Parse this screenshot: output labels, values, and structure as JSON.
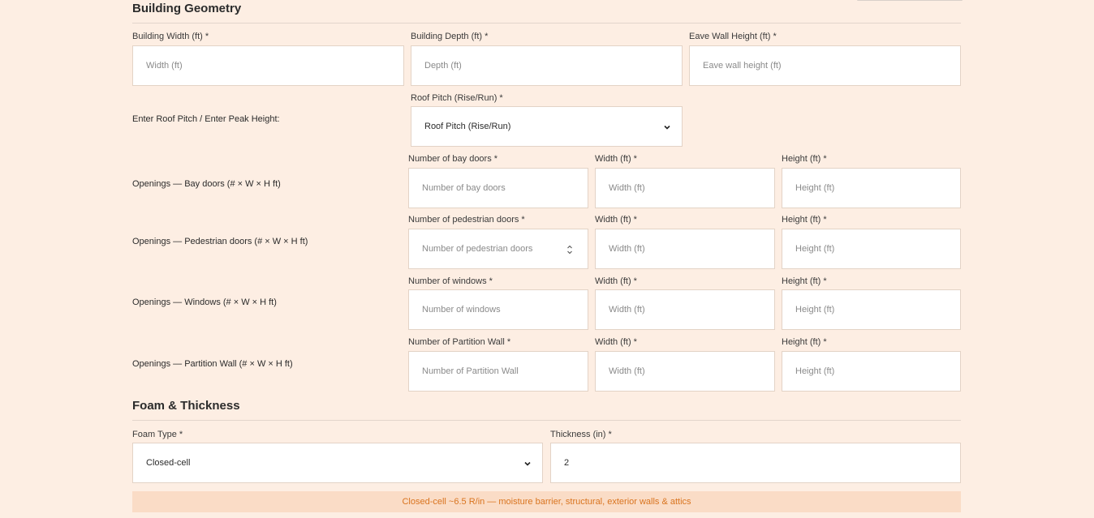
{
  "geometry": {
    "title": "Building Geometry",
    "width_label": "Building Width (ft) *",
    "width_placeholder": "Width (ft)",
    "depth_label": "Building Depth (ft) *",
    "depth_placeholder": "Depth (ft)",
    "eave_label": "Eave Wall Height (ft) *",
    "eave_placeholder": "Eave wall height (ft)",
    "roof_row_label": "Enter Roof Pitch / Enter Peak Height:",
    "roof_label": "Roof Pitch (Rise/Run) *",
    "roof_value": "Roof Pitch (Rise/Run)"
  },
  "openings": [
    {
      "row_label": "Openings — Bay doors (# × W × H ft)",
      "count_label": "Number of bay doors *",
      "count_placeholder": "Number of bay doors",
      "width_label": "Width (ft) *",
      "width_placeholder": "Width (ft)",
      "height_label": "Height (ft) *",
      "height_placeholder": "Height (ft)"
    },
    {
      "row_label": "Openings — Pedestrian doors (# × W × H ft)",
      "count_label": "Number of pedestrian doors *",
      "count_placeholder": "Number of pedestrian doors",
      "width_label": "Width (ft) *",
      "width_placeholder": "Width (ft)",
      "height_label": "Height (ft) *",
      "height_placeholder": "Height (ft)"
    },
    {
      "row_label": "Openings — Windows (# × W × H ft)",
      "count_label": "Number of windows *",
      "count_placeholder": "Number of windows",
      "width_label": "Width (ft) *",
      "width_placeholder": "Width (ft)",
      "height_label": "Height (ft) *",
      "height_placeholder": "Height (ft)"
    },
    {
      "row_label": "Openings — Partition Wall (# × W × H ft)",
      "count_label": "Number of Partition Wall *",
      "count_placeholder": "Number of Partition Wall",
      "width_label": "Width (ft) *",
      "width_placeholder": "Width (ft)",
      "height_label": "Height (ft) *",
      "height_placeholder": "Height (ft)"
    }
  ],
  "foam": {
    "title": "Foam & Thickness",
    "type_label": "Foam Type *",
    "type_value": "Closed-cell",
    "thickness_label": "Thickness (in) *",
    "thickness_value": "2",
    "note": "Closed-cell ~6.5 R/in — moisture barrier, structural, exterior walls & attics"
  },
  "colors": {
    "background": "#fdeee3",
    "note_background": "#fadcc6",
    "note_text": "#d9741f"
  },
  "icons": {
    "select_arrow": "chevron-down-icon",
    "number_spinner": "spinner-icon"
  }
}
